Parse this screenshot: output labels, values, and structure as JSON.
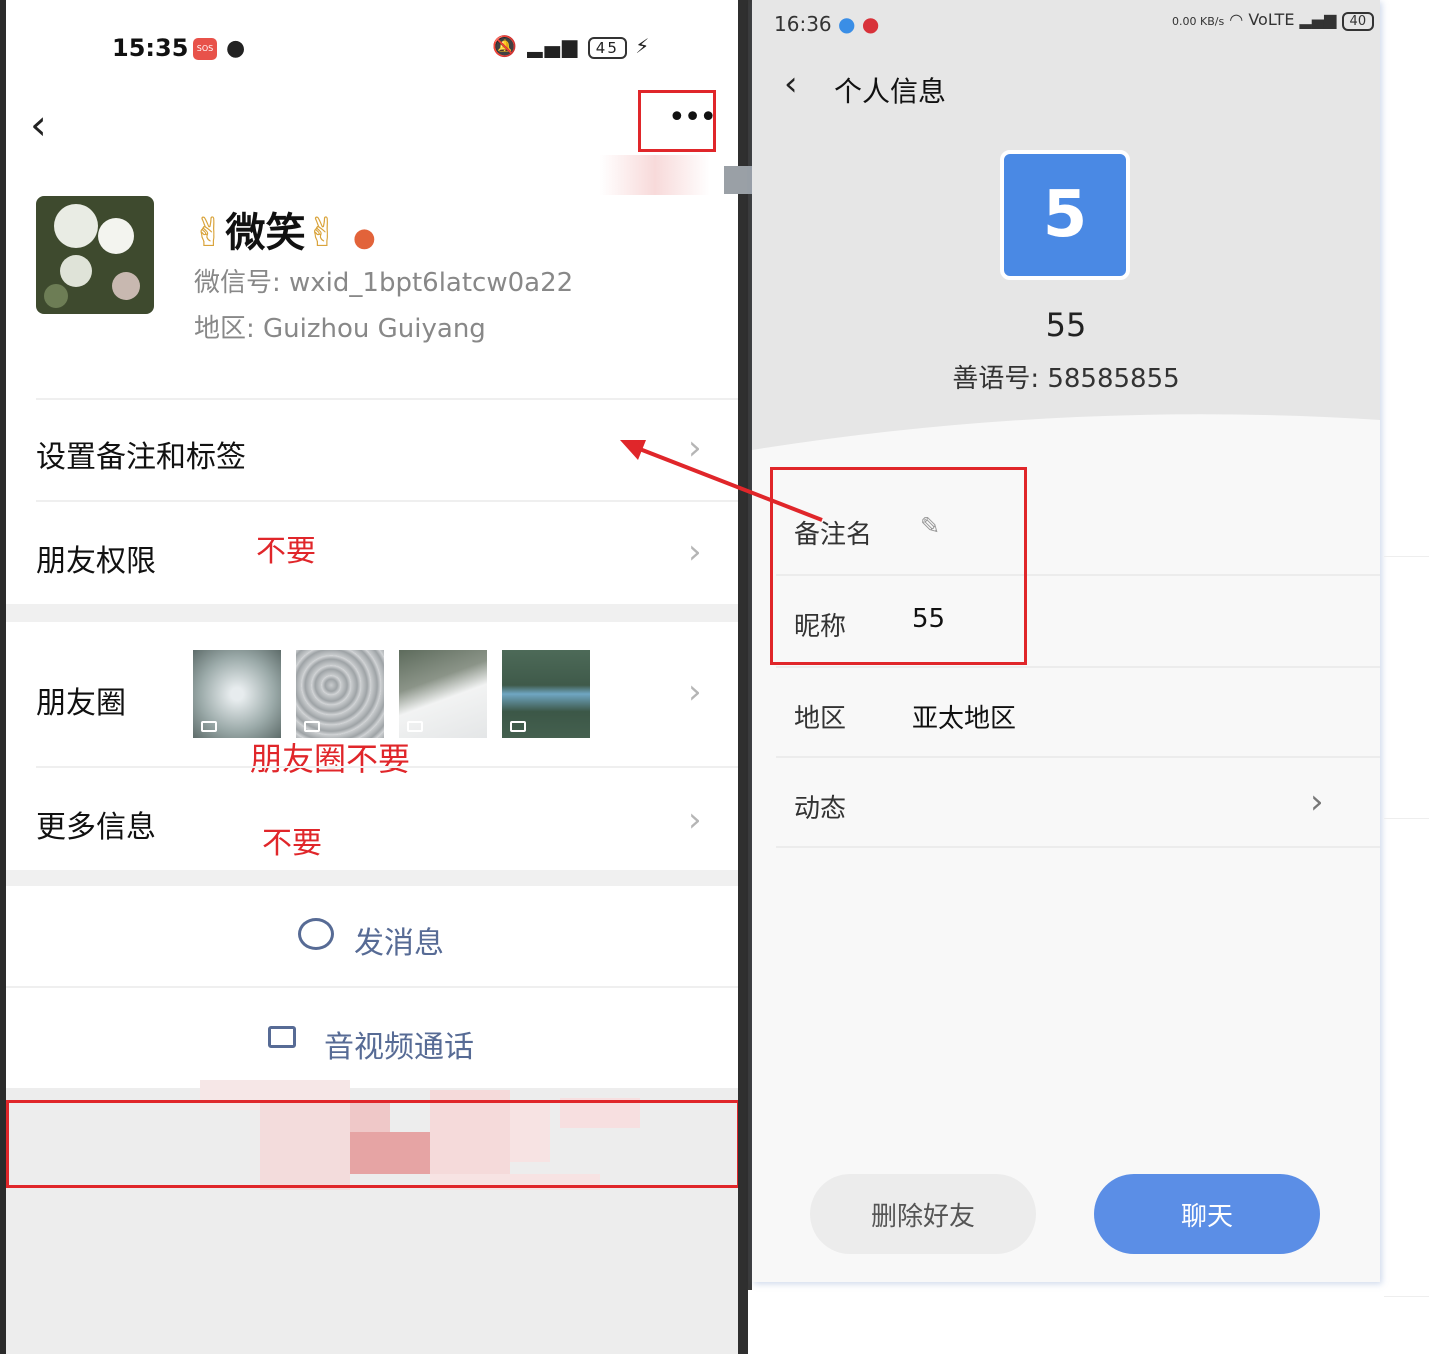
{
  "left": {
    "status": {
      "time": "15:35",
      "sos": "SOS",
      "battery": "45"
    },
    "profile": {
      "nickname": "微笑",
      "wechat_id": "微信号: wxid_1bpt6latcw0a22",
      "region": "地区: Guizhou  Guiyang"
    },
    "rows": {
      "remark_tags": "设置备注和标签",
      "friend_perm": "朋友权限",
      "moments": "朋友圈",
      "more_info": "更多信息"
    },
    "notes": {
      "perm_no": "不要",
      "moments_no": "朋友圈不要",
      "more_no": "不要"
    },
    "actions": {
      "send_msg": "发消息",
      "av_call": "音视频通话"
    }
  },
  "right": {
    "status": {
      "time": "16:36",
      "speed": "0.00 KB/s",
      "volte": "VoLTE",
      "battery": "40"
    },
    "header": {
      "title": "个人信息"
    },
    "profile": {
      "avatar_text": "5",
      "name": "55",
      "id": "善语号: 58585855"
    },
    "fields": {
      "remark_label": "备注名",
      "nick_label": "昵称",
      "nick_value": "55",
      "region_label": "地区",
      "region_value": "亚太地区",
      "moments_label": "动态"
    },
    "buttons": {
      "delete": "删除好友",
      "chat": "聊天"
    }
  },
  "colors": {
    "annotation_red": "#e0262a",
    "wechat_link": "#576b95",
    "chat_blue": "#5b8ee6",
    "avatar_blue": "#4a89e4"
  }
}
